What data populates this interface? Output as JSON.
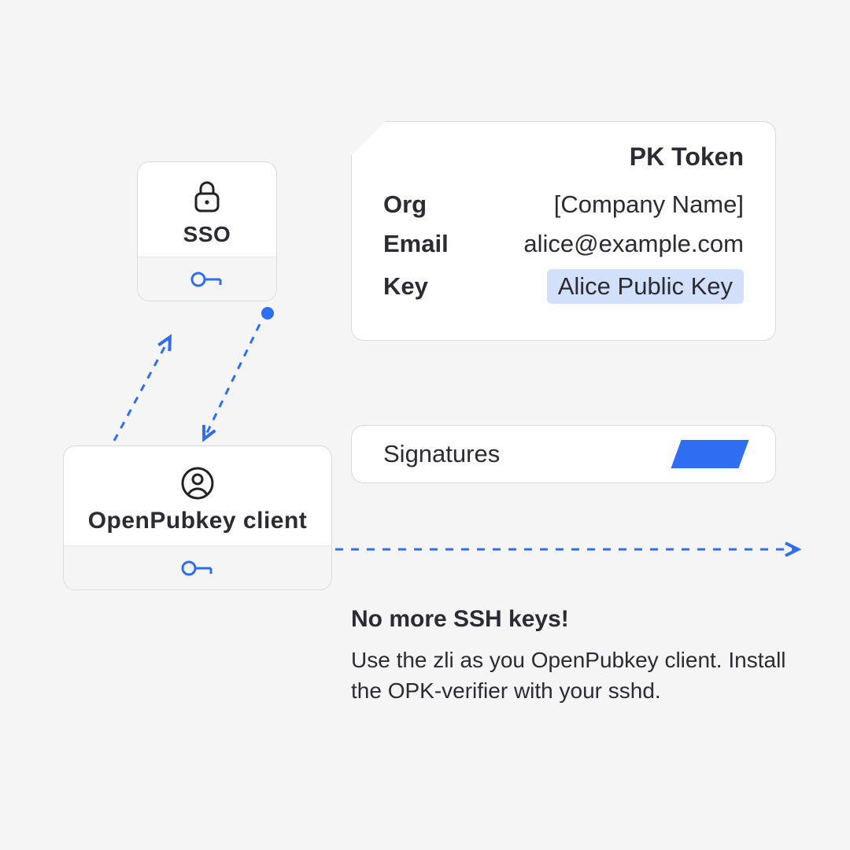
{
  "sso": {
    "label": "SSO"
  },
  "client": {
    "label": "OpenPubkey client"
  },
  "pk_token": {
    "title": "PK Token",
    "rows": [
      {
        "label": "Org",
        "value": "[Company Name]"
      },
      {
        "label": "Email",
        "value": "alice@example.com"
      },
      {
        "label": "Key",
        "value": "Alice Public Key"
      }
    ]
  },
  "signatures": {
    "label": "Signatures"
  },
  "caption": {
    "headline": "No more SSH keys!",
    "body": "Use the zli as you OpenPubkey client. Install the OPK-verifier with your sshd."
  },
  "colors": {
    "accent": "#2f6ef0",
    "highlight_bg": "#d3e0fb",
    "card_bg": "#ffffff",
    "page_bg": "#f5f5f5"
  }
}
